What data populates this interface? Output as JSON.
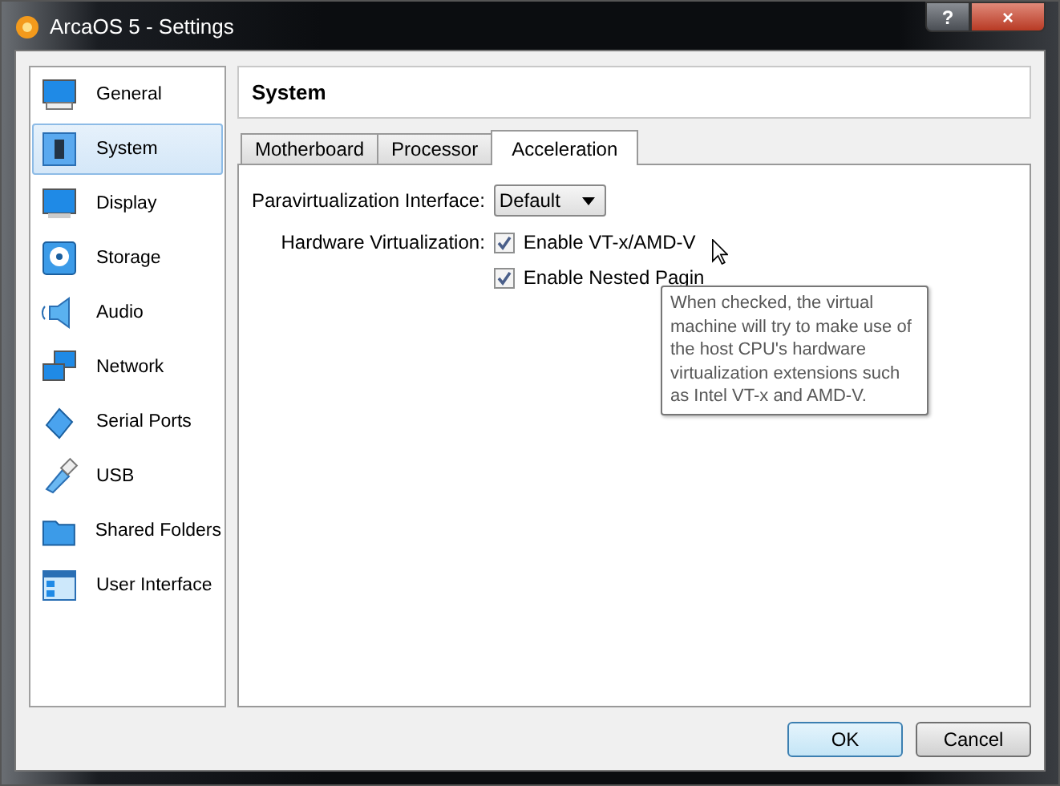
{
  "window": {
    "title": "ArcaOS 5 - Settings",
    "buttons": [
      "?",
      "×"
    ]
  },
  "sidebar": {
    "items": [
      {
        "label": "General",
        "selected": false
      },
      {
        "label": "System",
        "selected": true
      },
      {
        "label": "Display",
        "selected": false
      },
      {
        "label": "Storage",
        "selected": false
      },
      {
        "label": "Audio",
        "selected": false
      },
      {
        "label": "Network",
        "selected": false
      },
      {
        "label": "Serial Ports",
        "selected": false
      },
      {
        "label": "USB",
        "selected": false
      },
      {
        "label": "Shared Folders",
        "selected": false
      },
      {
        "label": "User Interface",
        "selected": false
      }
    ]
  },
  "page_title": "System",
  "tabs": [
    {
      "label": "Motherboard",
      "selected": false
    },
    {
      "label": "Processor",
      "selected": false
    },
    {
      "label": "Acceleration",
      "selected": true
    }
  ],
  "paravirtualization": {
    "label": "Paravirtualization Interface:",
    "value": "Default"
  },
  "hardware_virtualization": {
    "label": "Hardware Virtualization:",
    "options": [
      {
        "label": "Enable VT-x/AMD-V",
        "checked": true
      },
      {
        "label": "Enable Nested Pagin",
        "checked": true
      }
    ]
  },
  "tooltip": "When checked, the virtual machine will try to make use of the host CPU's hardware virtualization extensions such as Intel VT-x and AMD-V.",
  "buttons": [
    {
      "label": "OK",
      "default": true
    },
    {
      "label": "Cancel",
      "default": false
    }
  ]
}
